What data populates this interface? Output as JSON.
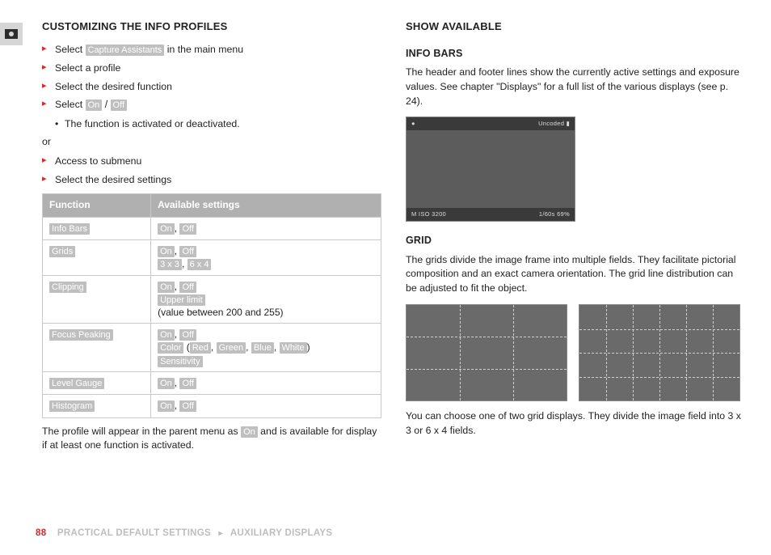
{
  "left": {
    "heading": "CUSTOMIZING THE INFO PROFILES",
    "steps1": {
      "s1a": "Select ",
      "s1chip": "Capture Assistants",
      "s1b": " in the main menu",
      "s2": "Select a profile",
      "s3": "Select the desired function",
      "s4a": "Select ",
      "s4chipOn": "On",
      "s4chipOff": "Off"
    },
    "bullet1": "The function is activated or deactivated.",
    "or": "or",
    "steps2": {
      "s5": "Access to submenu",
      "s6": "Select the desired settings"
    },
    "table": {
      "h1": "Function",
      "h2": "Available settings",
      "r1f": "Info Bars",
      "r2f": "Grids",
      "r2extra1": "3 x 3",
      "r2extra2": "6 x 4",
      "r3f": "Clipping",
      "r3extra": "Upper limit",
      "r3note": "(value between 200 and 255)",
      "r4f": "Focus Peaking",
      "r4color": "Color",
      "r4red": "Red",
      "r4green": "Green",
      "r4blue": "Blue",
      "r4white": "White",
      "r4sens": "Sensitivity",
      "r5f": "Level Gauge",
      "r6f": "Histogram",
      "on": "On",
      "off": "Off"
    },
    "after_a": "The profile will appear in the parent menu as ",
    "after_chip": "On",
    "after_b": " and is available for display if at least one function is activated."
  },
  "right": {
    "heading": "SHOW AVAILABLE",
    "sub1": "INFO BARS",
    "p1": "The header and footer lines show the currently active settings and exposure values. See chapter \"Displays\" for a full list of the various displays (see p. 24).",
    "frame_top_left": "●",
    "frame_top_right": "Uncoded  ▮",
    "frame_bot_left": "M   ISO 3200",
    "frame_bot_right": "1/60s    69%",
    "sub2": "GRID",
    "p2": "The grids divide the image frame into multiple fields. They facilitate pictorial composition and an exact camera orientation. The grid line distribution can be adjusted to fit the object.",
    "p3": "You can choose one of two grid displays. They divide the image field into 3 x 3 or 6 x 4 fields."
  },
  "footer": {
    "page": "88",
    "crumb1": "PRACTICAL DEFAULT SETTINGS",
    "crumb2": "AUXILIARY DISPLAYS"
  }
}
